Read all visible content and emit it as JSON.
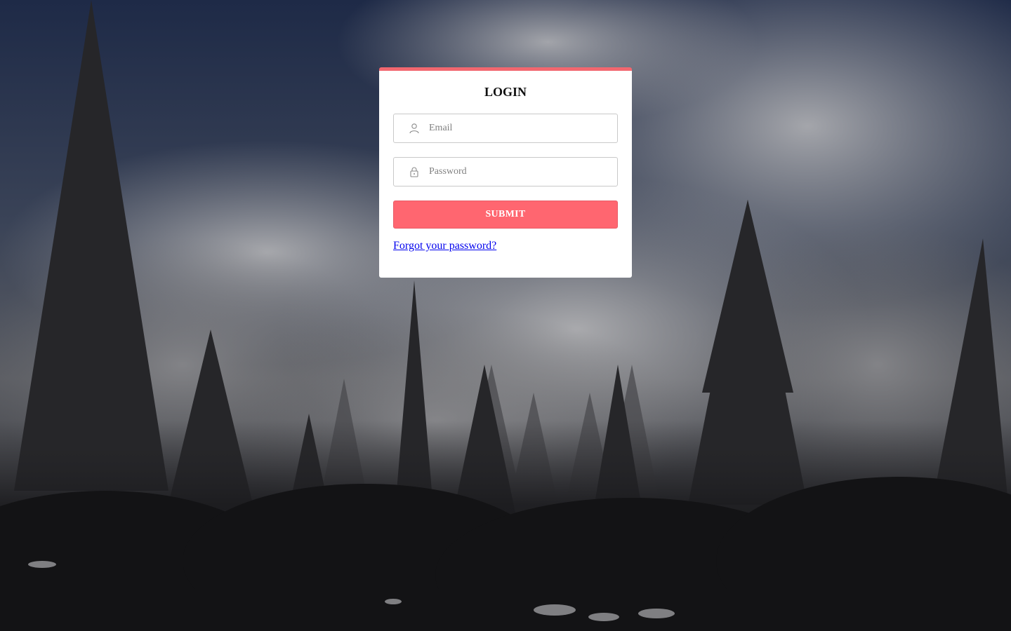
{
  "login": {
    "title": "LOGIN",
    "email": {
      "placeholder": "Email",
      "value": "",
      "icon": "user-icon"
    },
    "password": {
      "placeholder": "Password",
      "value": "",
      "icon": "lock-icon"
    },
    "submit_label": "SUBMIT",
    "forgot_label": "Forgot your password?"
  },
  "colors": {
    "accent": "#ff6670",
    "card_border_top": "#f2676f",
    "link": "#0000ee"
  },
  "background": {
    "description_icon": "forest-mist-background"
  }
}
